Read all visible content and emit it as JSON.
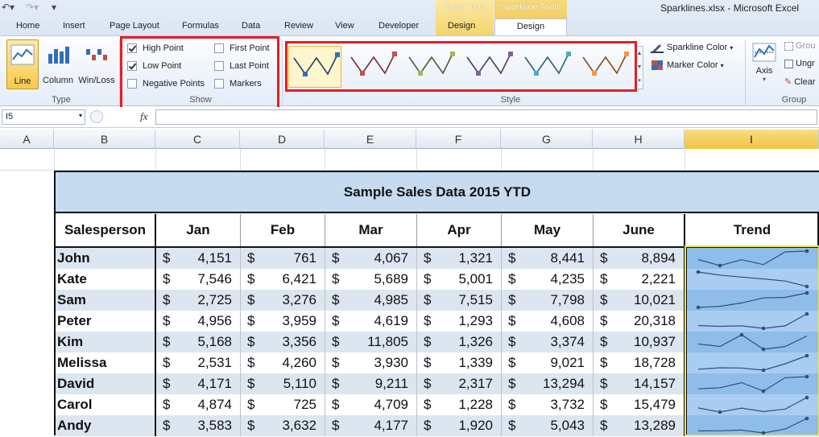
{
  "window": {
    "title": "Sparklines.xlsx - Microsoft Excel"
  },
  "contextual": {
    "table_tools": "Table Tools",
    "sparkline_tools": "Sparkline Tools"
  },
  "tabs": [
    "Home",
    "Insert",
    "Page Layout",
    "Formulas",
    "Data",
    "Review",
    "View",
    "Developer",
    "Design",
    "Design"
  ],
  "active_tab_index": 9,
  "ribbon": {
    "type_group": {
      "label": "Type",
      "buttons": [
        "Line",
        "Column",
        "Win/Loss"
      ],
      "active": "Line"
    },
    "show_group": {
      "label": "Show",
      "options": [
        {
          "label": "High Point",
          "checked": true
        },
        {
          "label": "Low Point",
          "checked": true
        },
        {
          "label": "Negative Points",
          "checked": false
        },
        {
          "label": "First Point",
          "checked": false
        },
        {
          "label": "Last Point",
          "checked": false
        },
        {
          "label": "Markers",
          "checked": false
        }
      ]
    },
    "style_group": {
      "label": "Style",
      "thumb_colors": [
        {
          "line": "#1f3f66",
          "marker": "#2f6fb8"
        },
        {
          "line": "#7a2a2a",
          "marker": "#c0504d"
        },
        {
          "line": "#4f5a2a",
          "marker": "#9bbb59"
        },
        {
          "line": "#4a3b66",
          "marker": "#8064a2"
        },
        {
          "line": "#2a6270",
          "marker": "#4bacc6"
        },
        {
          "line": "#8a4a1a",
          "marker": "#f79646"
        }
      ],
      "sparkline_color": "Sparkline Color",
      "marker_color": "Marker Color"
    },
    "group_group": {
      "label": "Group",
      "axis": "Axis",
      "group": "Grou",
      "ungroup": "Ungr",
      "clear": "Clear"
    }
  },
  "formula_bar": {
    "name_box": "I5",
    "fx": "fx",
    "value": ""
  },
  "columns": [
    "A",
    "B",
    "C",
    "D",
    "E",
    "F",
    "G",
    "H",
    "I"
  ],
  "selected_column": "I",
  "table": {
    "title": "Sample Sales Data 2015 YTD",
    "headers": [
      "Salesperson",
      "Jan",
      "Feb",
      "Mar",
      "Apr",
      "May",
      "June",
      "Trend"
    ],
    "currency": "$",
    "rows": [
      {
        "name": "John",
        "values": [
          "4,151",
          "761",
          "4,067",
          "1,321",
          "8,441",
          "8,894"
        ]
      },
      {
        "name": "Kate",
        "values": [
          "7,546",
          "6,421",
          "5,689",
          "5,001",
          "4,235",
          "2,221"
        ]
      },
      {
        "name": "Sam",
        "values": [
          "2,725",
          "3,276",
          "4,985",
          "7,515",
          "7,798",
          "10,021"
        ]
      },
      {
        "name": "Peter",
        "values": [
          "4,956",
          "3,959",
          "4,619",
          "1,293",
          "4,608",
          "20,318"
        ]
      },
      {
        "name": "Kim",
        "values": [
          "5,168",
          "3,356",
          "11,805",
          "1,326",
          "3,374",
          "10,937"
        ]
      },
      {
        "name": "Melissa",
        "values": [
          "2,531",
          "4,260",
          "3,930",
          "1,339",
          "9,021",
          "18,728"
        ]
      },
      {
        "name": "David",
        "values": [
          "4,171",
          "5,110",
          "9,211",
          "2,317",
          "13,294",
          "14,157"
        ]
      },
      {
        "name": "Carol",
        "values": [
          "4,874",
          "725",
          "4,709",
          "1,228",
          "3,732",
          "15,479"
        ]
      },
      {
        "name": "Andy",
        "values": [
          "3,583",
          "3,632",
          "4,177",
          "1,920",
          "5,043",
          "13,289"
        ]
      }
    ]
  },
  "colors": {
    "sparkline": "#2f4f7f",
    "trend_fill": "#a9cdf1",
    "trend_fill_alt": "#8ebde9",
    "header_fill": "#c6daf0",
    "row_fill": "#dce6f1"
  }
}
